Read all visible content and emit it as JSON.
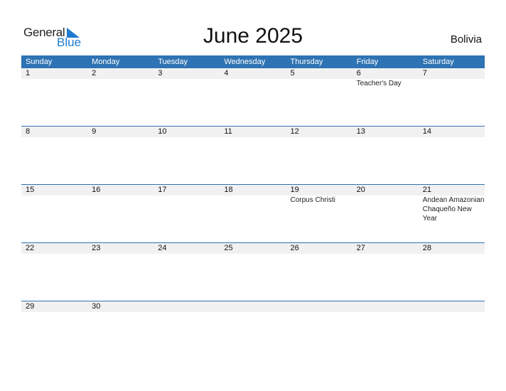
{
  "logo": {
    "general": "General",
    "blue": "Blue",
    "icon": "triangle-flag-icon",
    "brand_color": "#1f7ad1"
  },
  "title": "June 2025",
  "country": "Bolivia",
  "header_color": "#2e73b3",
  "weekdays": [
    "Sunday",
    "Monday",
    "Tuesday",
    "Wednesday",
    "Thursday",
    "Friday",
    "Saturday"
  ],
  "weeks": [
    [
      {
        "d": "1",
        "e": ""
      },
      {
        "d": "2",
        "e": ""
      },
      {
        "d": "3",
        "e": ""
      },
      {
        "d": "4",
        "e": ""
      },
      {
        "d": "5",
        "e": ""
      },
      {
        "d": "6",
        "e": "Teacher's Day"
      },
      {
        "d": "7",
        "e": ""
      }
    ],
    [
      {
        "d": "8",
        "e": ""
      },
      {
        "d": "9",
        "e": ""
      },
      {
        "d": "10",
        "e": ""
      },
      {
        "d": "11",
        "e": ""
      },
      {
        "d": "12",
        "e": ""
      },
      {
        "d": "13",
        "e": ""
      },
      {
        "d": "14",
        "e": ""
      }
    ],
    [
      {
        "d": "15",
        "e": ""
      },
      {
        "d": "16",
        "e": ""
      },
      {
        "d": "17",
        "e": ""
      },
      {
        "d": "18",
        "e": ""
      },
      {
        "d": "19",
        "e": "Corpus Christi"
      },
      {
        "d": "20",
        "e": ""
      },
      {
        "d": "21",
        "e": "Andean Amazonian Chaqueño New Year"
      }
    ],
    [
      {
        "d": "22",
        "e": ""
      },
      {
        "d": "23",
        "e": ""
      },
      {
        "d": "24",
        "e": ""
      },
      {
        "d": "25",
        "e": ""
      },
      {
        "d": "26",
        "e": ""
      },
      {
        "d": "27",
        "e": ""
      },
      {
        "d": "28",
        "e": ""
      }
    ],
    [
      {
        "d": "29",
        "e": ""
      },
      {
        "d": "30",
        "e": ""
      },
      {
        "d": "",
        "e": ""
      },
      {
        "d": "",
        "e": ""
      },
      {
        "d": "",
        "e": ""
      },
      {
        "d": "",
        "e": ""
      },
      {
        "d": "",
        "e": ""
      }
    ]
  ]
}
